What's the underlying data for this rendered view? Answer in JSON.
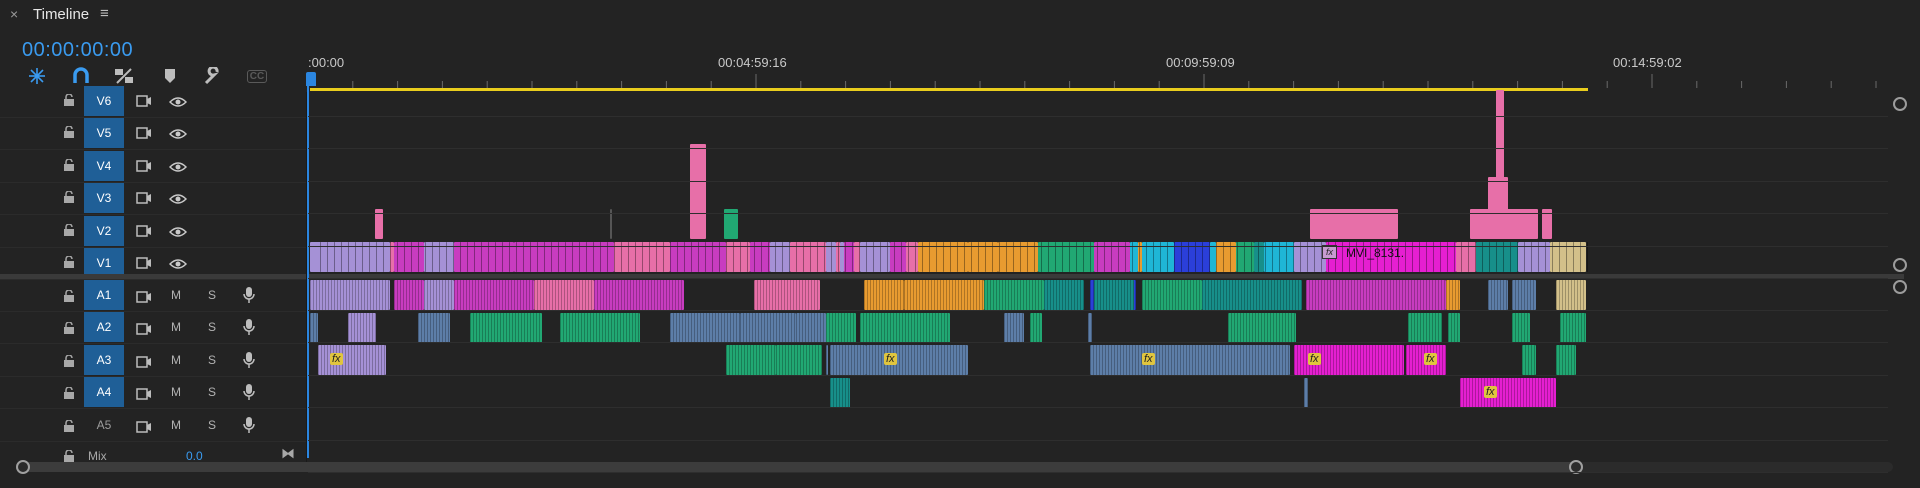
{
  "panel": {
    "title": "Timeline",
    "close": "×",
    "menu": "≡"
  },
  "timecode": "00:00:00:00",
  "toolbar": {
    "tools": [
      "nest-sequence-icon",
      "snap-magnet-icon",
      "linked-selection-icon",
      "add-marker-icon",
      "settings-wrench-icon",
      "captions-icon"
    ],
    "captions_label": "CC",
    "accent": "#3a9bf0"
  },
  "ruler": {
    "labels": [
      ":00:00",
      "00:04:59:16",
      "00:09:59:09",
      "00:14:59:02"
    ]
  },
  "video_tracks": [
    {
      "name": "V6",
      "active": true
    },
    {
      "name": "V5",
      "active": true
    },
    {
      "name": "V4",
      "active": true
    },
    {
      "name": "V3",
      "active": true
    },
    {
      "name": "V2",
      "active": true
    },
    {
      "name": "V1",
      "active": true
    }
  ],
  "audio_tracks": [
    {
      "name": "A1",
      "active": true,
      "mute": "M",
      "solo": "S"
    },
    {
      "name": "A2",
      "active": true,
      "mute": "M",
      "solo": "S"
    },
    {
      "name": "A3",
      "active": true,
      "mute": "M",
      "solo": "S"
    },
    {
      "name": "A4",
      "active": true,
      "mute": "M",
      "solo": "S"
    },
    {
      "name": "A5",
      "active": false,
      "mute": "M",
      "solo": "S"
    }
  ],
  "mix": {
    "label": "Mix",
    "value": "0.0"
  },
  "clip_label": "MVI_8131.",
  "fx_label": "fx",
  "colors": {
    "lavender": "#a591d6",
    "magenta": "#c83cc0",
    "pink": "#e76fa8",
    "orange": "#e89b30",
    "green": "#21a873",
    "cyan": "#1fb6d6",
    "blue": "#2b3fd9",
    "teal": "#178f8a",
    "tan": "#d3c08a",
    "hotpink": "#e51fd1",
    "steel": "#5d7ea8",
    "workbar": "#e9cd1d",
    "playhead": "#2b86e0"
  }
}
